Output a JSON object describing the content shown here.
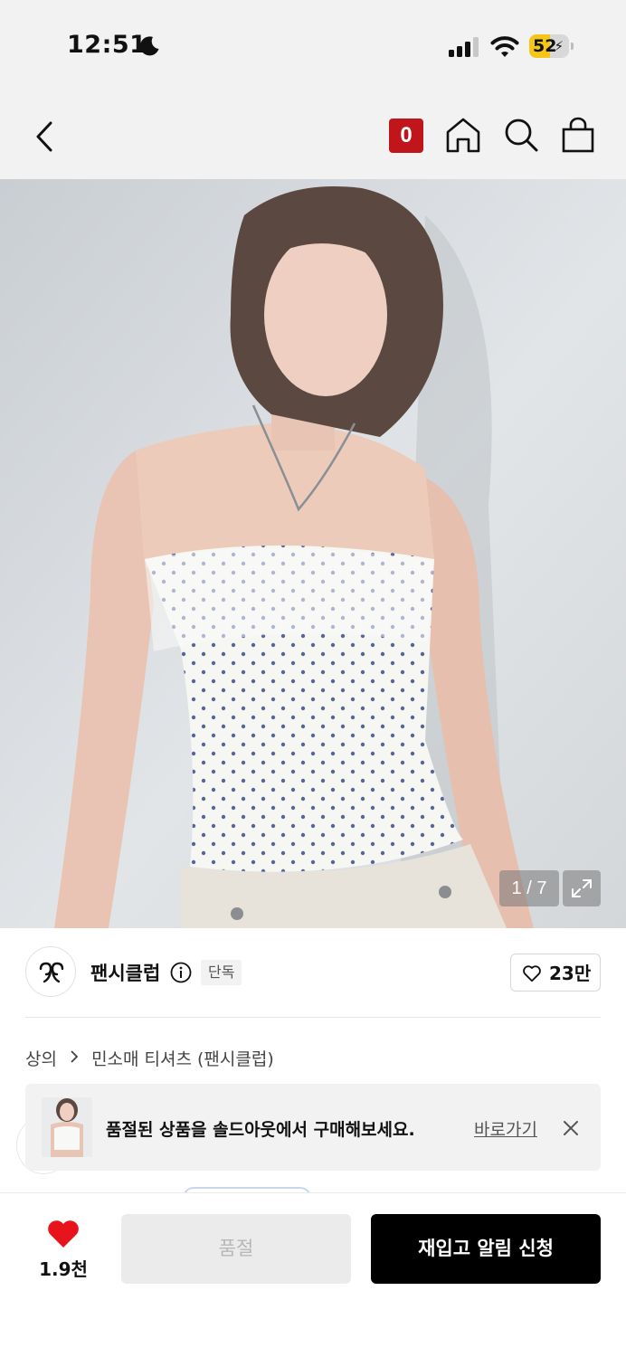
{
  "status_bar": {
    "time": "12:51",
    "battery_percent": "52",
    "battery_level": 0.52,
    "icons": [
      "moon-icon",
      "cellular-signal-icon",
      "wifi-icon",
      "battery-icon"
    ]
  },
  "nav": {
    "icons": [
      "back-arrow-icon",
      "home-icon",
      "search-icon",
      "shopping-bag-icon"
    ],
    "cart_count": "0",
    "accent_color": "#c0161b"
  },
  "gallery": {
    "counter": "1 / 7",
    "current": 1,
    "total": 7,
    "icons": [
      "expand-icon"
    ]
  },
  "brand": {
    "name": "팬시클럽",
    "badge": "단독",
    "likes": "23만",
    "icons": [
      "brand-logo-icon",
      "info-icon",
      "heart-outline-icon"
    ]
  },
  "breadcrumb": {
    "category": "상의",
    "subcategory": "민소매 티셔츠 (팬시클럽)",
    "separator_icon": "chevron-right-icon"
  },
  "soldout_banner": {
    "message": "품절된 상품을 솔드아웃에서 구매해보세요.",
    "link": "바로가기",
    "icons": [
      "close-icon"
    ]
  },
  "bottom_bar": {
    "wish_count": "1.9천",
    "wish_color": "#e8141c",
    "soldout_label": "품절",
    "restock_label": "재입고 알림 신청",
    "icons": [
      "heart-filled-icon"
    ]
  }
}
